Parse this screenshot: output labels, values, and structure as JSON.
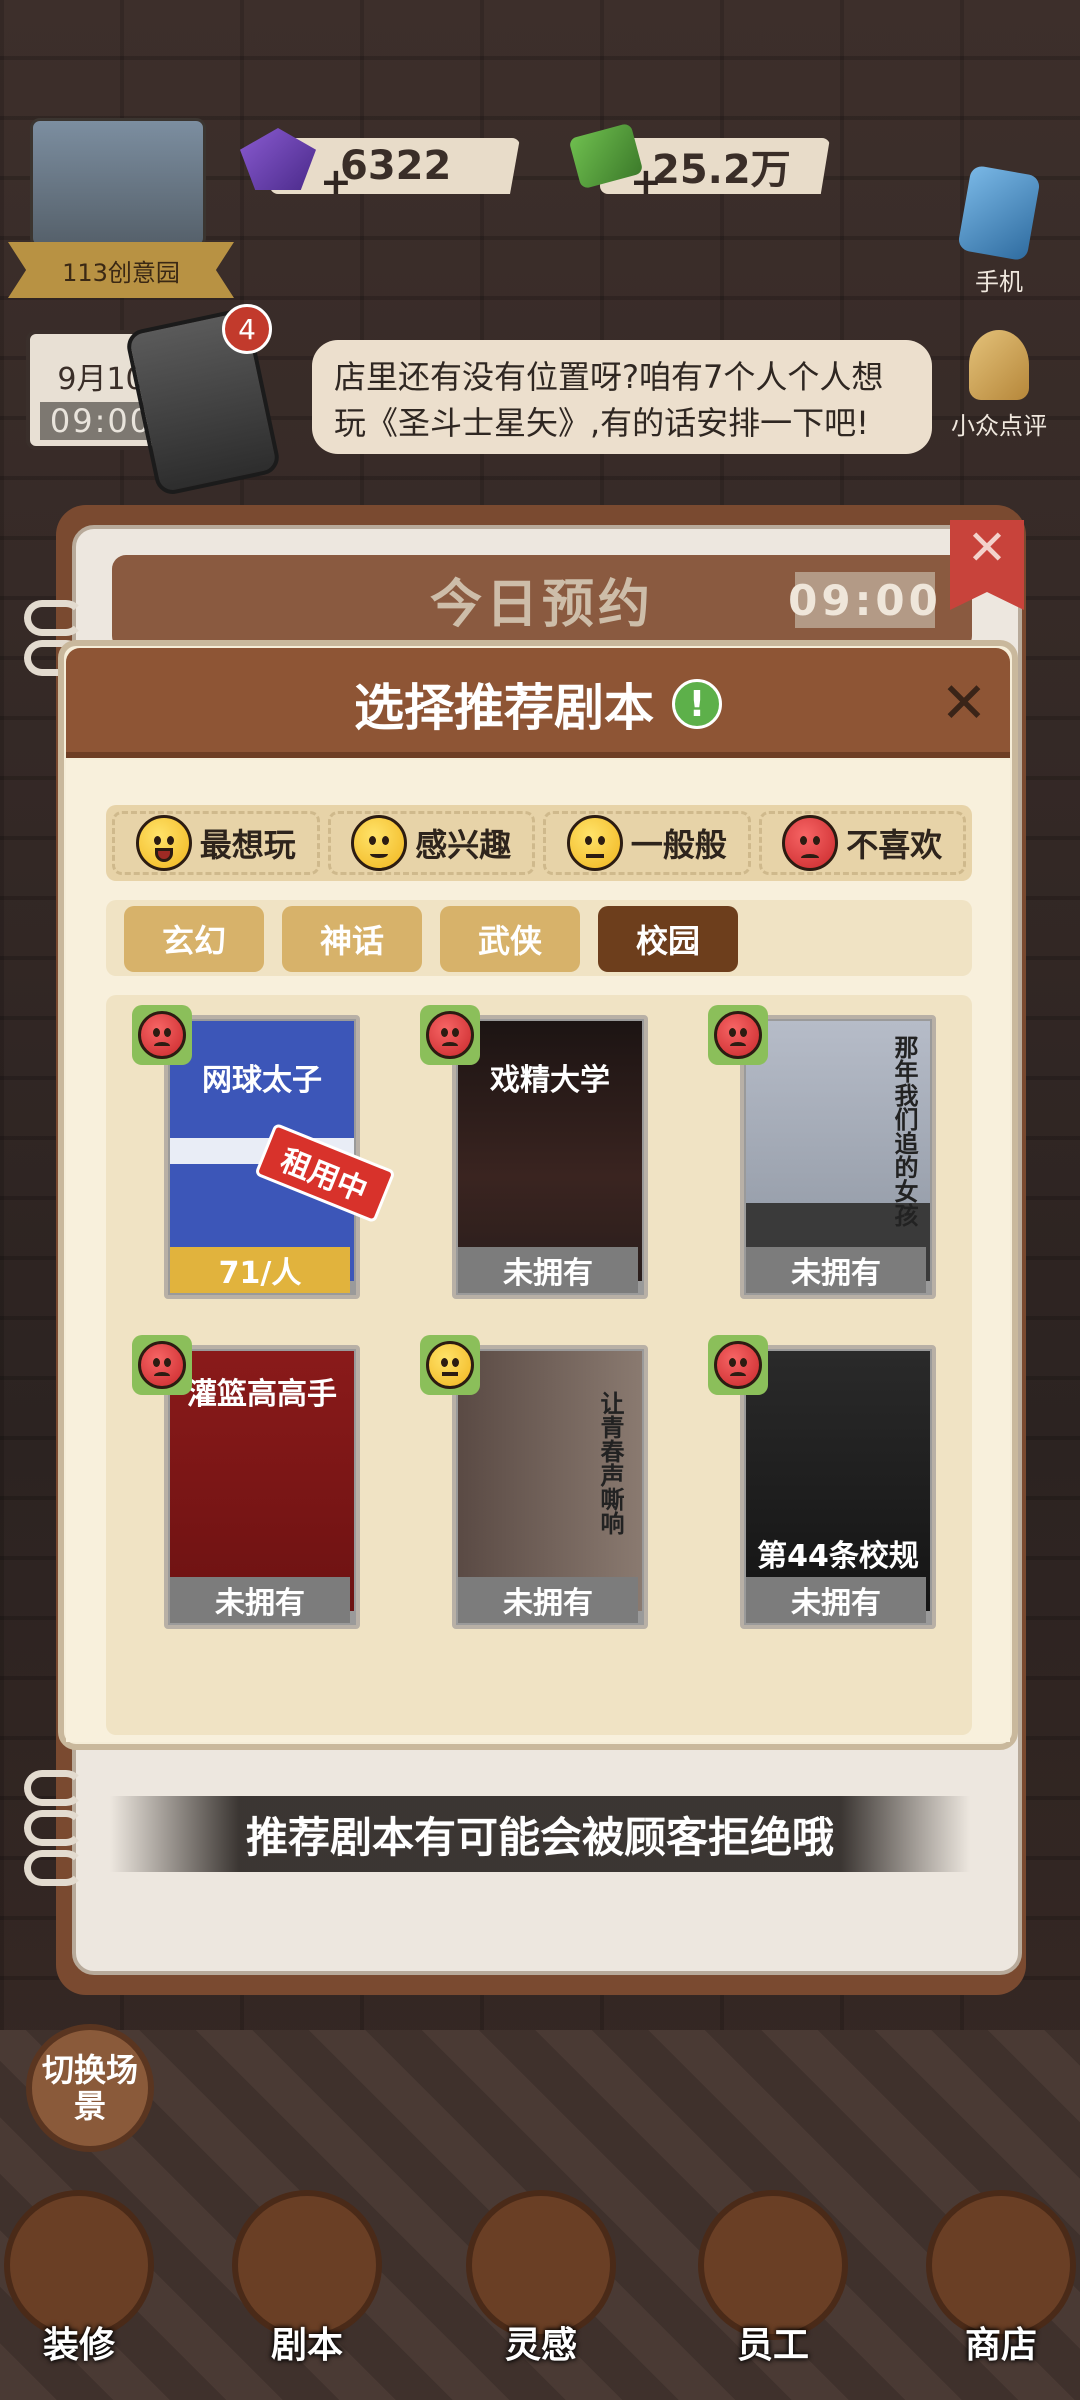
{
  "hud": {
    "location": "113创意园",
    "gems": "6322",
    "cash": "25.2万",
    "phone_label": "手机",
    "review_label": "小众点评"
  },
  "calendar": {
    "date": "9月10",
    "time": "09:00"
  },
  "phone_notification_count": "4",
  "speech_bubble": "店里还有没有位置呀?咱有7个人个人想玩《圣斗士星矢》,有的话安排一下吧!",
  "background_panel": {
    "title": "今日预约",
    "time": "09:00"
  },
  "modal": {
    "title": "选择推荐剧本",
    "legend": [
      {
        "label": "最想玩",
        "face": "love"
      },
      {
        "label": "感兴趣",
        "face": "wink"
      },
      {
        "label": "一般般",
        "face": "neutral"
      },
      {
        "label": "不喜欢",
        "face": "angry"
      }
    ],
    "tabs": [
      "玄幻",
      "神话",
      "武侠",
      "校园"
    ],
    "active_tab": "校园",
    "scripts": [
      {
        "title": "网球太子",
        "status": "71/人",
        "rented_tag": "租用中",
        "reaction": "angry",
        "poster_color": "#3c56b8"
      },
      {
        "title": "戏精大学",
        "status": "未拥有",
        "reaction": "angry",
        "poster_color": "#2a1e1c"
      },
      {
        "title": "那年我们追的女孩",
        "status": "未拥有",
        "reaction": "angry",
        "poster_color": "#aab0bd"
      },
      {
        "title": "灌篮高高手",
        "status": "未拥有",
        "reaction": "angry",
        "poster_color": "#8a1a1a"
      },
      {
        "title": "让青春声嘶响",
        "status": "未拥有",
        "reaction": "neutral",
        "poster_color": "#7a6a62"
      },
      {
        "title": "第44条校规",
        "status": "未拥有",
        "reaction": "angry",
        "poster_color": "#1e1e1e"
      }
    ]
  },
  "hint_text": "推荐剧本有可能会被顾客拒绝哦",
  "switch_scene": "切换场景",
  "bottom_nav": [
    "装修",
    "剧本",
    "灵感",
    "员工",
    "商店"
  ],
  "colors": {
    "header_brown": "#8e5535",
    "active_tab": "#6d3e1c",
    "inactive_tab": "#d7b26a",
    "rent_tag": "#d8322b",
    "price_gold": "#e1b33d"
  }
}
